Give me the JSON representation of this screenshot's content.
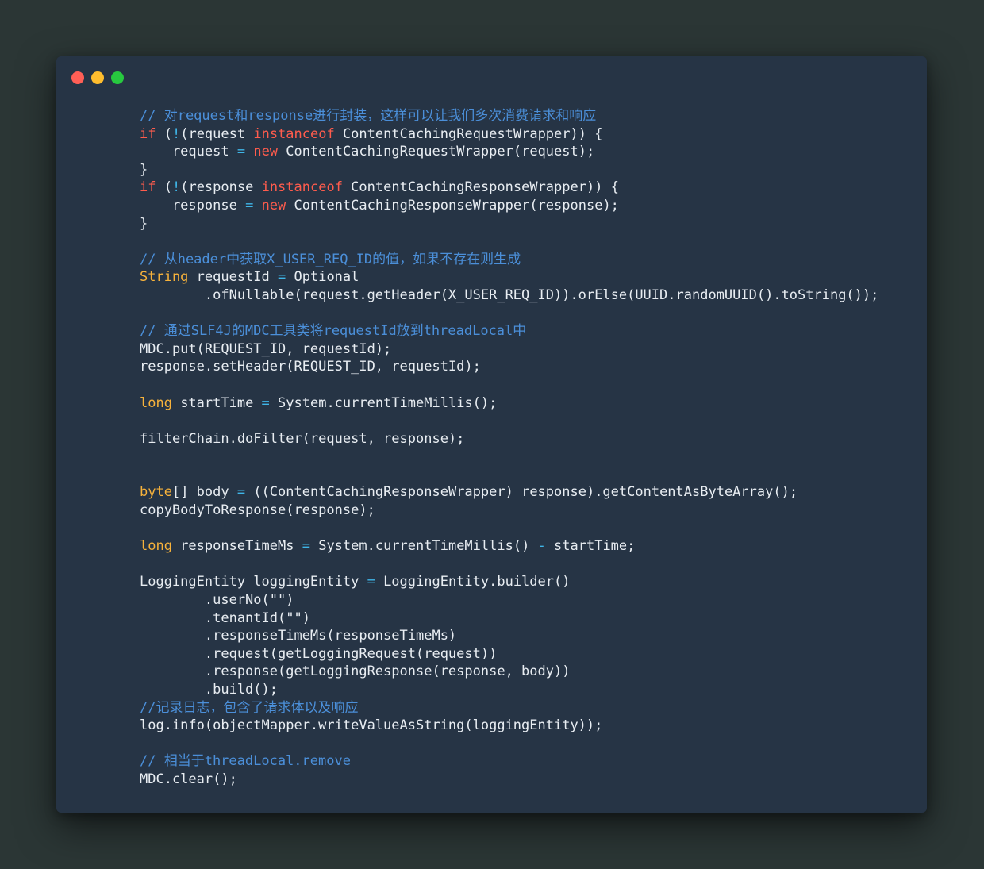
{
  "window": {
    "traffic_lights": {
      "close_color": "#ff5f56",
      "minimize_color": "#ffbd2e",
      "maximize_color": "#27c93f"
    }
  },
  "colors": {
    "background": "#2b3635",
    "panel": "#263445",
    "keyword": "#ff5c4d",
    "type": "#f7b23b",
    "comment": "#4b8fd9",
    "operator": "#3fb6e8",
    "text": "#e8edf2"
  },
  "code_lines": [
    [
      {
        "t": "cmt",
        "s": "// 对request和response进行封装，这样可以让我们多次消费请求和响应"
      }
    ],
    [
      {
        "t": "kw",
        "s": "if"
      },
      {
        "t": "plain",
        "s": " ("
      },
      {
        "t": "op",
        "s": "!"
      },
      {
        "t": "plain",
        "s": "(request "
      },
      {
        "t": "kw",
        "s": "instanceof"
      },
      {
        "t": "plain",
        "s": " ContentCachingRequestWrapper)) {"
      }
    ],
    [
      {
        "t": "plain",
        "s": "    request "
      },
      {
        "t": "op",
        "s": "="
      },
      {
        "t": "plain",
        "s": " "
      },
      {
        "t": "kw",
        "s": "new"
      },
      {
        "t": "plain",
        "s": " ContentCachingRequestWrapper(request);"
      }
    ],
    [
      {
        "t": "plain",
        "s": "}"
      }
    ],
    [
      {
        "t": "kw",
        "s": "if"
      },
      {
        "t": "plain",
        "s": " ("
      },
      {
        "t": "op",
        "s": "!"
      },
      {
        "t": "plain",
        "s": "(response "
      },
      {
        "t": "kw",
        "s": "instanceof"
      },
      {
        "t": "plain",
        "s": " ContentCachingResponseWrapper)) {"
      }
    ],
    [
      {
        "t": "plain",
        "s": "    response "
      },
      {
        "t": "op",
        "s": "="
      },
      {
        "t": "plain",
        "s": " "
      },
      {
        "t": "kw",
        "s": "new"
      },
      {
        "t": "plain",
        "s": " ContentCachingResponseWrapper(response);"
      }
    ],
    [
      {
        "t": "plain",
        "s": "}"
      }
    ],
    [],
    [
      {
        "t": "cmt",
        "s": "// 从header中获取X_USER_REQ_ID的值，如果不存在则生成"
      }
    ],
    [
      {
        "t": "type",
        "s": "String"
      },
      {
        "t": "plain",
        "s": " requestId "
      },
      {
        "t": "op",
        "s": "="
      },
      {
        "t": "plain",
        "s": " Optional"
      }
    ],
    [
      {
        "t": "plain",
        "s": "        .ofNullable(request.getHeader(X_USER_REQ_ID)).orElse(UUID.randomUUID().toString());"
      }
    ],
    [],
    [
      {
        "t": "cmt",
        "s": "// 通过SLF4J的MDC工具类将requestId放到threadLocal中"
      }
    ],
    [
      {
        "t": "plain",
        "s": "MDC.put(REQUEST_ID, requestId);"
      }
    ],
    [
      {
        "t": "plain",
        "s": "response.setHeader(REQUEST_ID, requestId);"
      }
    ],
    [],
    [
      {
        "t": "type",
        "s": "long"
      },
      {
        "t": "plain",
        "s": " startTime "
      },
      {
        "t": "op",
        "s": "="
      },
      {
        "t": "plain",
        "s": " System.currentTimeMillis();"
      }
    ],
    [],
    [
      {
        "t": "plain",
        "s": "filterChain.doFilter(request, response);"
      }
    ],
    [],
    [],
    [
      {
        "t": "type",
        "s": "byte"
      },
      {
        "t": "plain",
        "s": "[] body "
      },
      {
        "t": "op",
        "s": "="
      },
      {
        "t": "plain",
        "s": " ((ContentCachingResponseWrapper) response).getContentAsByteArray();"
      }
    ],
    [
      {
        "t": "plain",
        "s": "copyBodyToResponse(response);"
      }
    ],
    [],
    [
      {
        "t": "type",
        "s": "long"
      },
      {
        "t": "plain",
        "s": " responseTimeMs "
      },
      {
        "t": "op",
        "s": "="
      },
      {
        "t": "plain",
        "s": " System.currentTimeMillis() "
      },
      {
        "t": "op",
        "s": "-"
      },
      {
        "t": "plain",
        "s": " startTime;"
      }
    ],
    [],
    [
      {
        "t": "plain",
        "s": "LoggingEntity loggingEntity "
      },
      {
        "t": "op",
        "s": "="
      },
      {
        "t": "plain",
        "s": " LoggingEntity.builder()"
      }
    ],
    [
      {
        "t": "plain",
        "s": "        .userNo("
      },
      {
        "t": "str",
        "s": "\"\""
      },
      {
        "t": "plain",
        "s": ")"
      }
    ],
    [
      {
        "t": "plain",
        "s": "        .tenantId("
      },
      {
        "t": "str",
        "s": "\"\""
      },
      {
        "t": "plain",
        "s": ")"
      }
    ],
    [
      {
        "t": "plain",
        "s": "        .responseTimeMs(responseTimeMs)"
      }
    ],
    [
      {
        "t": "plain",
        "s": "        .request(getLoggingRequest(request))"
      }
    ],
    [
      {
        "t": "plain",
        "s": "        .response(getLoggingResponse(response, body))"
      }
    ],
    [
      {
        "t": "plain",
        "s": "        .build();"
      }
    ],
    [
      {
        "t": "cmt",
        "s": "//记录日志，包含了请求体以及响应"
      }
    ],
    [
      {
        "t": "plain",
        "s": "log.info(objectMapper.writeValueAsString(loggingEntity));"
      }
    ],
    [],
    [
      {
        "t": "cmt",
        "s": "// 相当于threadLocal.remove"
      }
    ],
    [
      {
        "t": "plain",
        "s": "MDC.clear();"
      }
    ]
  ]
}
